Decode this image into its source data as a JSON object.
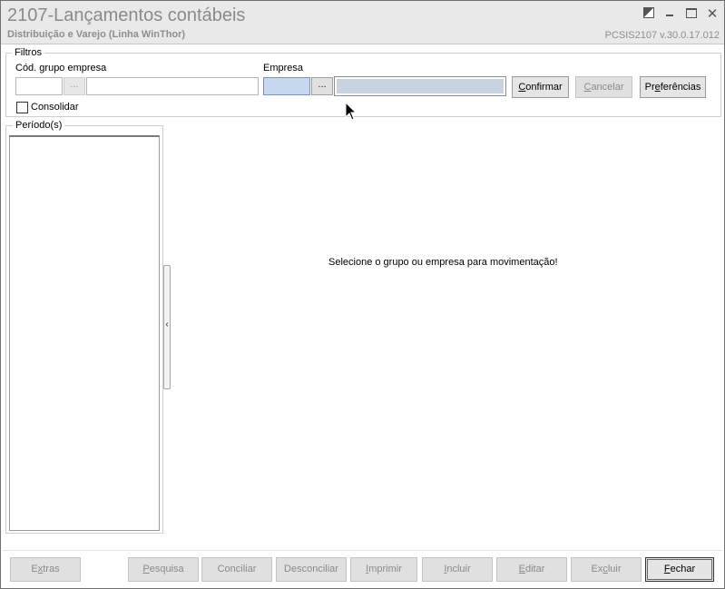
{
  "window": {
    "title": "2107-Lançamentos contábeis",
    "subtitle": "Distribuição e Varejo (Linha WinThor)",
    "version": "PCSIS2107  v.30.0.17.012"
  },
  "filters": {
    "legend": "Filtros",
    "grupo_label": "Cód. grupo empresa",
    "empresa_label": "Empresa",
    "lookup_label": "...",
    "consolidar_label": "Consolidar",
    "consolidar_checked": false
  },
  "actions": {
    "confirmar_pre": "",
    "confirmar_key": "C",
    "confirmar_post": "onfirmar",
    "cancelar_pre": "",
    "cancelar_key": "C",
    "cancelar_post": "ancelar",
    "preferencias_pre": "Pr",
    "preferencias_key": "e",
    "preferencias_post": "ferências"
  },
  "periodos": {
    "legend": "Período(s)",
    "items": []
  },
  "main": {
    "message": "Selecione o grupo ou empresa para movimentação!"
  },
  "toolbar": {
    "extras_pre": "E",
    "extras_key": "x",
    "extras_post": "tras",
    "pesquisa_pre": "",
    "pesquisa_key": "P",
    "pesquisa_post": "esquisa",
    "conciliar": "Conciliar",
    "desconciliar": "Desconciliar",
    "imprimir_pre": "",
    "imprimir_key": "I",
    "imprimir_post": "mprimir",
    "incluir_pre": "",
    "incluir_key": "I",
    "incluir_post": "ncluir",
    "editar_pre": "",
    "editar_key": "E",
    "editar_post": "ditar",
    "excluir_pre": "Ex",
    "excluir_key": "c",
    "excluir_post": "luir",
    "fechar_pre": "",
    "fechar_key": "F",
    "fechar_post": "echar"
  },
  "colors": {
    "titlebar_bg": "#e9e9e9",
    "selected_input": "#c8d9ef",
    "disabled_text": "#8a8a8a"
  }
}
